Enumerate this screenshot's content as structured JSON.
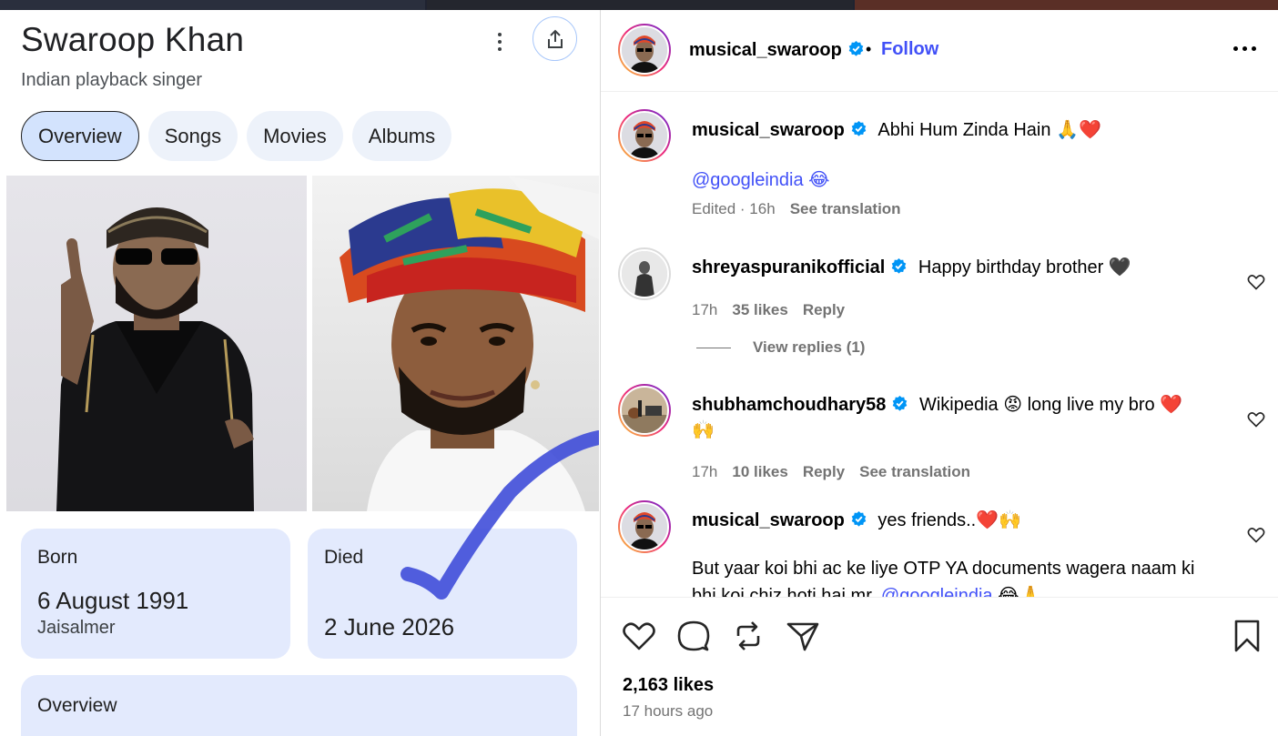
{
  "colors": {
    "google_chip_bg": "#edf2fa",
    "google_chip_active_bg": "#d3e3fd",
    "fact_card_bg": "#e3eafd",
    "instagram_link": "#4150f7",
    "instagram_meta": "#737373",
    "heart_red": "#e0142b"
  },
  "knowledge_panel": {
    "title": "Swaroop Khan",
    "subtitle": "Indian playback singer",
    "tabs": [
      {
        "label": "Overview",
        "active": true
      },
      {
        "label": "Songs",
        "active": false
      },
      {
        "label": "Movies",
        "active": false
      },
      {
        "label": "Albums",
        "active": false
      }
    ],
    "born": {
      "label": "Born",
      "date": "6 August 1991",
      "place": "Jaisalmer"
    },
    "died": {
      "label": "Died",
      "date": "2 June 2026"
    },
    "overview": {
      "label": "Overview"
    },
    "icons": {
      "more": "more-vert-icon",
      "share": "share-icon"
    }
  },
  "instagram": {
    "header": {
      "username": "musical_swaroop",
      "separator": "•",
      "follow_label": "Follow"
    },
    "caption": {
      "username": "musical_swaroop",
      "text": "Abhi Hum Zinda Hain 🙏❤️",
      "mention_line": "@googleindia 😂",
      "meta": "Edited · 16h",
      "translation": "See translation"
    },
    "comments": [
      {
        "username": "shreyaspuranikofficial",
        "text": "Happy birthday brother 🖤",
        "time": "17h",
        "likes": "35 likes",
        "reply": "Reply",
        "view_replies": "View replies (1)"
      },
      {
        "username": "shubhamchoudhary58",
        "text": "Wikipedia 😡 long live my bro ❤️",
        "text_line2": "🙌",
        "time": "17h",
        "likes": "10 likes",
        "reply": "Reply",
        "translation": "See translation"
      },
      {
        "username": "musical_swaroop",
        "text": "yes friends..❤️🙌",
        "text_line2": "But yaar koi bhi ac ke liye OTP YA documents wagera naam ki",
        "text_line3": "bhi koi chiz hoti hai mr.",
        "mention": "@googleindia",
        "text_line3_end": "😂🙏"
      }
    ],
    "footer": {
      "likes": "2,163 likes",
      "time_ago": "17 hours ago"
    },
    "icons": [
      "heart-icon",
      "comment-icon",
      "repost-icon",
      "share-icon",
      "bookmark-icon",
      "verified-icon",
      "more-horizontal-icon"
    ]
  }
}
